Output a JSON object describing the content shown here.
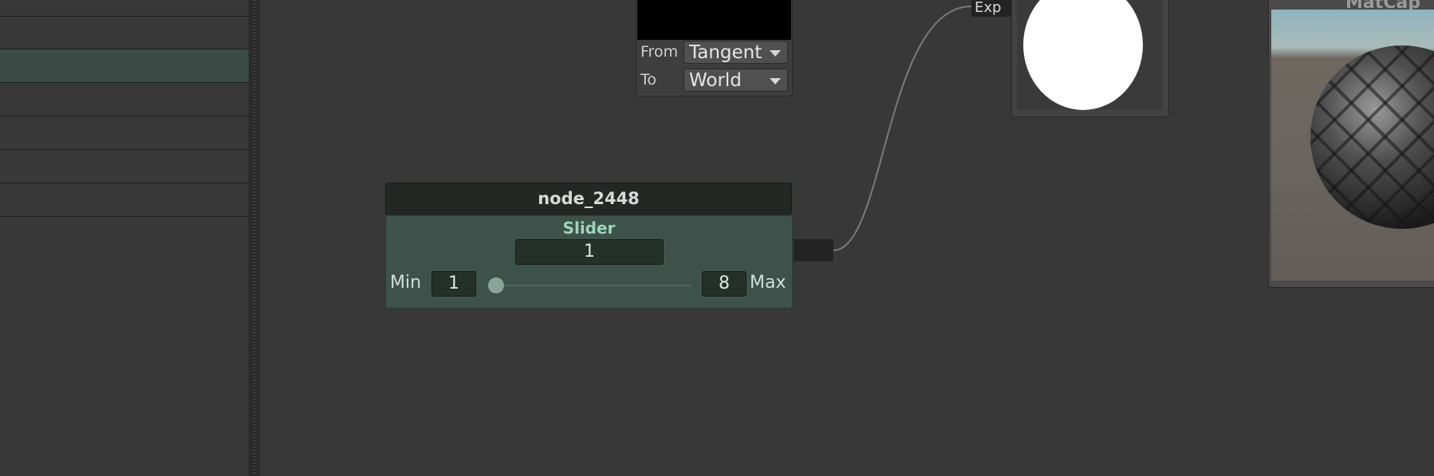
{
  "transform_node": {
    "from_label": "From",
    "from_value": "Tangent",
    "to_label": "To",
    "to_value": "World"
  },
  "exp_port_label": "Exp",
  "matcap_node": {
    "title": "MatCap"
  },
  "slider_node": {
    "name": "node_2448",
    "type": "Slider",
    "value": "1",
    "min_label": "Min",
    "min_value": "1",
    "max_label": "Max",
    "max_value": "8",
    "slider_fraction": 0.0
  },
  "colors": {
    "canvas": "#383838",
    "slider_node_body": "#3d524a",
    "slider_node_accent": "#9fd3bb",
    "selected_row": "#3a4a44"
  }
}
